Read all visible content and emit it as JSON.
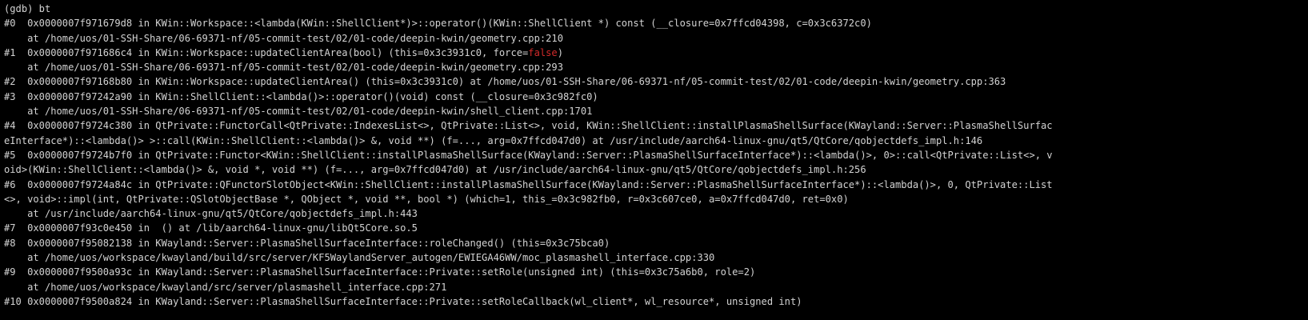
{
  "terminal": {
    "lines": [
      [
        {
          "t": "(gdb) bt"
        }
      ],
      [
        {
          "t": "#0  0x0000007f971679d8 in KWin::Workspace::<lambda(KWin::ShellClient*)>::operator()(KWin::ShellClient *) const (__closure=0x7ffcd04398, c=0x3c6372c0)"
        }
      ],
      [
        {
          "t": "    at /home/uos/01-SSH-Share/06-69371-nf/05-commit-test/02/01-code/deepin-kwin/geometry.cpp:210"
        }
      ],
      [
        {
          "t": "#1  0x0000007f971686c4 in KWin::Workspace::updateClientArea(bool) (this=0x3c3931c0, force="
        },
        {
          "t": "false",
          "c": "false"
        },
        {
          "t": ")"
        }
      ],
      [
        {
          "t": "    at /home/uos/01-SSH-Share/06-69371-nf/05-commit-test/02/01-code/deepin-kwin/geometry.cpp:293"
        }
      ],
      [
        {
          "t": "#2  0x0000007f97168b80 in KWin::Workspace::updateClientArea() (this=0x3c3931c0) at /home/uos/01-SSH-Share/06-69371-nf/05-commit-test/02/01-code/deepin-kwin/geometry.cpp:363"
        }
      ],
      [
        {
          "t": "#3  0x0000007f97242a90 in KWin::ShellClient::<lambda()>::operator()(void) const (__closure=0x3c982fc0)"
        }
      ],
      [
        {
          "t": "    at /home/uos/01-SSH-Share/06-69371-nf/05-commit-test/02/01-code/deepin-kwin/shell_client.cpp:1701"
        }
      ],
      [
        {
          "t": "#4  0x0000007f9724c380 in QtPrivate::FunctorCall<QtPrivate::IndexesList<>, QtPrivate::List<>, void, KWin::ShellClient::installPlasmaShellSurface(KWayland::Server::PlasmaShellSurfac"
        }
      ],
      [
        {
          "t": "eInterface*)::<lambda()> >::call(KWin::ShellClient::<lambda()> &, void **) (f=..., arg=0x7ffcd047d0) at /usr/include/aarch64-linux-gnu/qt5/QtCore/qobjectdefs_impl.h:146"
        }
      ],
      [
        {
          "t": "#5  0x0000007f9724b7f0 in QtPrivate::Functor<KWin::ShellClient::installPlasmaShellSurface(KWayland::Server::PlasmaShellSurfaceInterface*)::<lambda()>, 0>::call<QtPrivate::List<>, v"
        }
      ],
      [
        {
          "t": "oid>(KWin::ShellClient::<lambda()> &, void *, void **) (f=..., arg=0x7ffcd047d0) at /usr/include/aarch64-linux-gnu/qt5/QtCore/qobjectdefs_impl.h:256"
        }
      ],
      [
        {
          "t": "#6  0x0000007f9724a84c in QtPrivate::QFunctorSlotObject<KWin::ShellClient::installPlasmaShellSurface(KWayland::Server::PlasmaShellSurfaceInterface*)::<lambda()>, 0, QtPrivate::List"
        }
      ],
      [
        {
          "t": "<>, void>::impl(int, QtPrivate::QSlotObjectBase *, QObject *, void **, bool *) (which=1, this_=0x3c982fb0, r=0x3c607ce0, a=0x7ffcd047d0, ret=0x0)"
        }
      ],
      [
        {
          "t": "    at /usr/include/aarch64-linux-gnu/qt5/QtCore/qobjectdefs_impl.h:443"
        }
      ],
      [
        {
          "t": "#7  0x0000007f93c0e450 in  () at /lib/aarch64-linux-gnu/libQt5Core.so.5"
        }
      ],
      [
        {
          "t": "#8  0x0000007f95082138 in KWayland::Server::PlasmaShellSurfaceInterface::roleChanged() (this=0x3c75bca0)"
        }
      ],
      [
        {
          "t": "    at /home/uos/workspace/kwayland/build/src/server/KF5WaylandServer_autogen/EWIEGA46WW/moc_plasmashell_interface.cpp:330"
        }
      ],
      [
        {
          "t": "#9  0x0000007f9500a93c in KWayland::Server::PlasmaShellSurfaceInterface::Private::setRole(unsigned int) (this=0x3c75a6b0, role=2)"
        }
      ],
      [
        {
          "t": "    at /home/uos/workspace/kwayland/src/server/plasmashell_interface.cpp:271"
        }
      ],
      [
        {
          "t": "#10 0x0000007f9500a824 in KWayland::Server::PlasmaShellSurfaceInterface::Private::setRoleCallback(wl_client*, wl_resource*, unsigned int)"
        }
      ]
    ]
  },
  "colors": {
    "background": "#000000",
    "text": "#d3d3d3",
    "false_keyword": "#d22a2a"
  }
}
